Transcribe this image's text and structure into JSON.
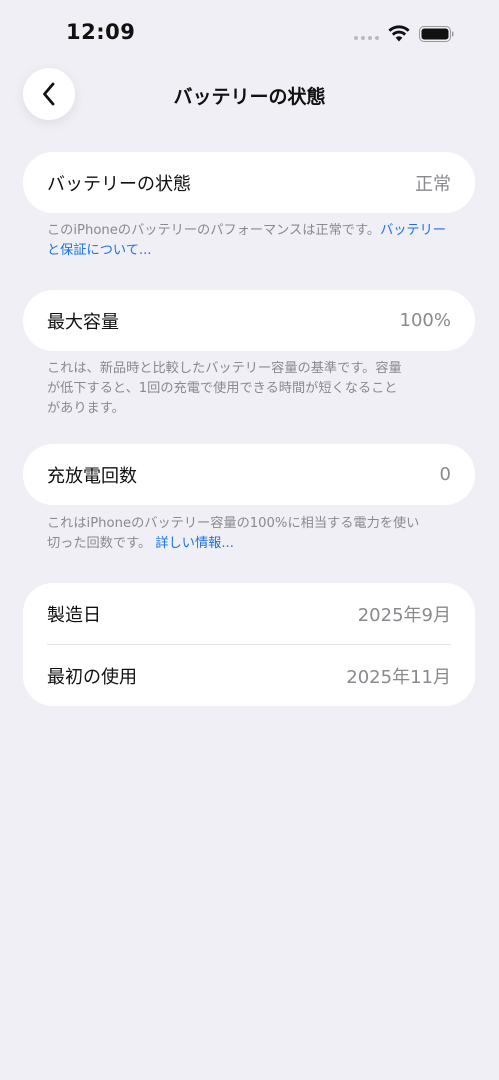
{
  "status_bar": {
    "time": "12:09"
  },
  "nav": {
    "title": "バッテリーの状態"
  },
  "battery_health": {
    "label": "バッテリーの状態",
    "value": "正常",
    "footnote_text": "このiPhoneのバッテリーのパフォーマンスは正常です。",
    "footnote_link": "バッテリーと保証について..."
  },
  "max_capacity": {
    "label": "最大容量",
    "value": "100%",
    "footnote_lines": [
      "これは、新品時と比較したバッテリー容量の基準です。容量",
      "が低下すると、1回の充電で使用できる時間が短くなること",
      "があります。"
    ]
  },
  "cycle_count": {
    "label": "充放電回数",
    "value": "0",
    "footnote_line1": "これはiPhoneのバッテリー容量の100%に相当する電力を使い",
    "footnote_line2": "切った回数です。",
    "footnote_link": "詳しい情報..."
  },
  "dates": {
    "manufacture_label": "製造日",
    "manufacture_value": "2025年9月",
    "first_use_label": "最初の使用",
    "first_use_value": "2025年11月"
  },
  "colors": {
    "background": "#f0eff5",
    "card": "#ffffff",
    "link": "#1a73e8",
    "secondary_text": "#8a8a8e"
  },
  "icons": [
    "wifi-icon",
    "battery-icon",
    "chevron-left-icon"
  ]
}
